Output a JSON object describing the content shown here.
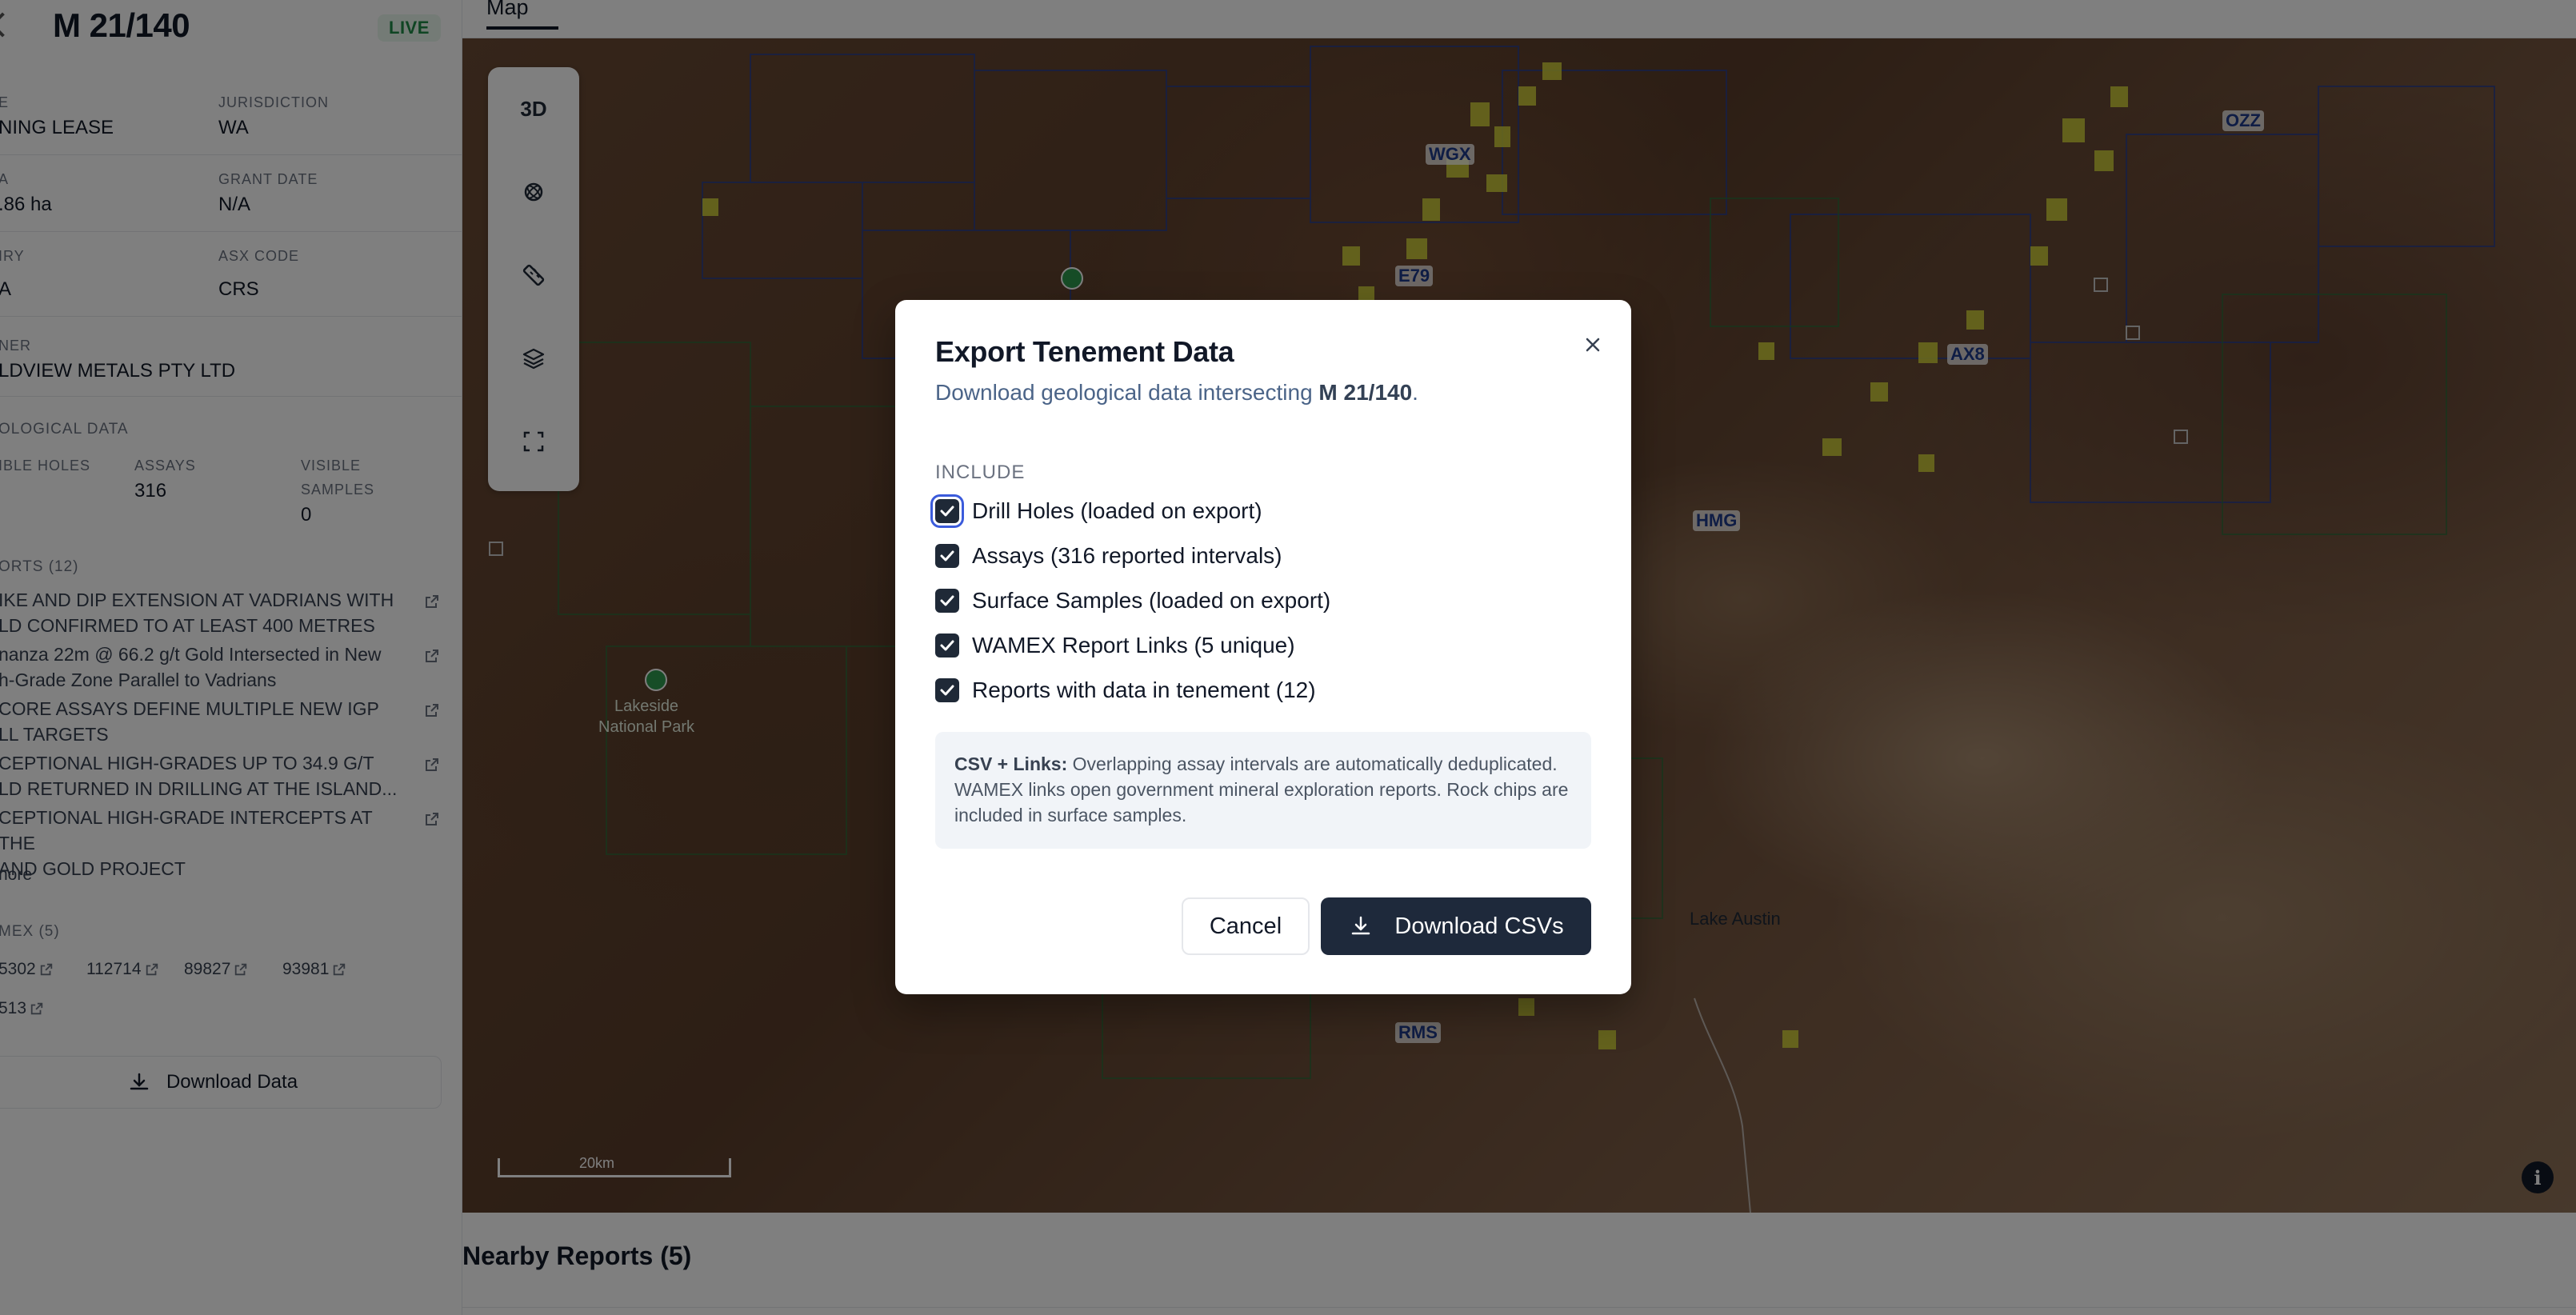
{
  "sidebar": {
    "title": "M 21/140",
    "status_badge": "LIVE",
    "fields": {
      "type_label": "E",
      "type_value": "NING LEASE",
      "jurisdiction_label": "JURISDICTION",
      "jurisdiction_value": "WA",
      "area_label": "A",
      "area_value": ".86 ha",
      "grant_date_label": "GRANT DATE",
      "grant_date_value": "N/A",
      "expiry_label": "IRY",
      "expiry_value": "A",
      "asx_code_label": "ASX CODE",
      "asx_code_value": "CRS",
      "owner_label": "NER",
      "owner_value": "LDVIEW METALS PTY LTD"
    },
    "geological": {
      "section_label": "OLOGICAL DATA",
      "holes_label": "IBLE HOLES",
      "assays_label": "ASSAYS",
      "assays_value": "316",
      "samples_label_1": "VISIBLE",
      "samples_label_2": "SAMPLES",
      "samples_value": "0"
    },
    "reports": {
      "section_label": "ORTS (12)",
      "items": [
        {
          "line1": "IKE AND DIP EXTENSION AT VADRIANS WITH",
          "line2": "LD CONFIRMED TO AT LEAST 400 METRES"
        },
        {
          "line1": "nanza 22m @ 66.2 g/t Gold Intersected in New",
          "line2": "h-Grade Zone Parallel to Vadrians"
        },
        {
          "line1": " CORE ASSAYS DEFINE MULTIPLE NEW IGP",
          "line2": "LL TARGETS"
        },
        {
          "line1": "CEPTIONAL HIGH-GRADES UP TO 34.9 G/T",
          "line2": "LD RETURNED IN DRILLING AT THE ISLAND..."
        },
        {
          "line1": "CEPTIONAL HIGH-GRADE INTERCEPTS AT THE",
          "line2": "AND GOLD PROJECT"
        }
      ],
      "more_label": "nore"
    },
    "wamex": {
      "section_label": "MEX (5)",
      "links": [
        "5302",
        "112714",
        "89827",
        "93981",
        "513"
      ]
    },
    "download_label": "Download Data"
  },
  "main": {
    "tab_label": "Map",
    "nearby_title": "Nearby Reports (5)"
  },
  "map": {
    "controls": {
      "view_3d": "3D"
    },
    "labels": [
      "WGX",
      "E79",
      "AX8",
      "OZZ",
      "HMG",
      "RMS"
    ],
    "park_label_1": "Lakeside",
    "park_label_2": "National Park",
    "lake_label": "Lake Austin",
    "scale_label": "20km",
    "info_glyph": "i"
  },
  "modal": {
    "title": "Export Tenement Data",
    "description_prefix": "Download geological data intersecting ",
    "description_tenement": "M 21/140",
    "description_suffix": ".",
    "include_label": "INCLUDE",
    "options": [
      {
        "label": "Drill Holes (loaded on export)",
        "checked": true
      },
      {
        "label": "Assays (316 reported intervals)",
        "checked": true
      },
      {
        "label": "Surface Samples (loaded on export)",
        "checked": true
      },
      {
        "label": "WAMEX Report Links (5 unique)",
        "checked": true
      },
      {
        "label": "Reports with data in tenement (12)",
        "checked": true
      }
    ],
    "info_bold": "CSV + Links:",
    "info_text": " Overlapping assay intervals are automatically deduplicated. WAMEX links open government mineral exploration reports. Rock chips are included in surface samples.",
    "cancel_label": "Cancel",
    "download_label": "Download CSVs"
  },
  "colors": {
    "primary_button": "#1e293b",
    "live_badge": "#1f8a46",
    "tenement_outline": "#2a3f8f",
    "tenement_fill": "#d8d83a"
  }
}
